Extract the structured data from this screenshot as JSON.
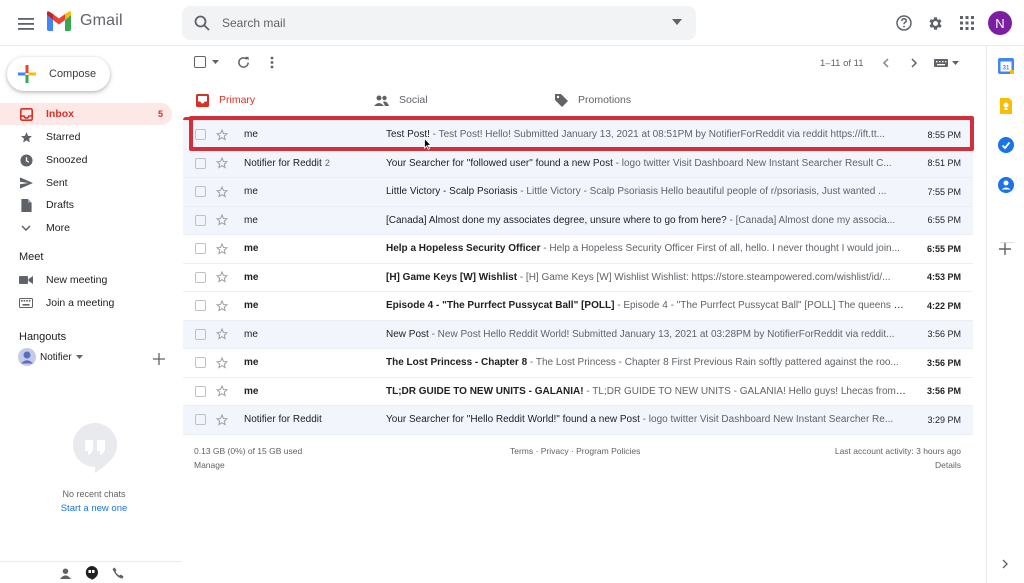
{
  "app": {
    "name": "Gmail",
    "avatar_letter": "N",
    "brand_color": "#d93025"
  },
  "search": {
    "placeholder": "Search mail"
  },
  "icons": [
    "menu-icon",
    "search-icon",
    "help-icon",
    "settings-icon",
    "apps-icon",
    "refresh-icon",
    "more-icon",
    "chevron-left-icon",
    "chevron-right-icon",
    "keyboard-icon"
  ],
  "sidebar": {
    "compose_label": "Compose",
    "items": [
      {
        "label": "Inbox",
        "count": "5",
        "icon": "inbox-icon",
        "active": true
      },
      {
        "label": "Starred",
        "icon": "star-icon"
      },
      {
        "label": "Snoozed",
        "icon": "clock-icon"
      },
      {
        "label": "Sent",
        "icon": "send-icon"
      },
      {
        "label": "Drafts",
        "icon": "draft-icon"
      },
      {
        "label": "More",
        "icon": "chevron-down-icon"
      }
    ],
    "meet": {
      "title": "Meet",
      "new_meeting": "New meeting",
      "join_meeting": "Join a meeting"
    },
    "hangouts": {
      "title": "Hangouts",
      "user": "Notifier",
      "no_chats": "No recent chats",
      "start_new": "Start a new one"
    }
  },
  "toolbar": {
    "pagination": "1–11 of 11"
  },
  "tabs": [
    {
      "label": "Primary",
      "icon": "inbox-icon"
    },
    {
      "label": "Social",
      "icon": "people-icon"
    },
    {
      "label": "Promotions",
      "icon": "tag-icon"
    }
  ],
  "emails": [
    {
      "sender": "me",
      "count": "",
      "subject": "Test Post!",
      "snippet": " - Test Post! Hello! Submitted January 13, 2021 at 08:51PM by NotifierForReddit via reddit https://ift.tt...",
      "time": "8:55 PM",
      "unread": false
    },
    {
      "sender": "Notifier for Reddit",
      "count": "2",
      "subject": "Your Searcher for \"followed user\" found a new Post",
      "snippet": " - logo twitter Visit Dashboard New Instant Searcher Result C...",
      "time": "8:51 PM",
      "unread": false
    },
    {
      "sender": "me",
      "count": "",
      "subject": "Little Victory - Scalp Psoriasis",
      "snippet": " - Little Victory - Scalp Psoriasis Hello beautiful people of r/psoriasis, Just wanted ...",
      "time": "7:55 PM",
      "unread": false
    },
    {
      "sender": "me",
      "count": "",
      "subject": "[Canada] Almost done my associates degree, unsure where to go from here?",
      "snippet": " - [Canada] Almost done my associa...",
      "time": "6:55 PM",
      "unread": false
    },
    {
      "sender": "me",
      "count": "",
      "subject": "Help a Hopeless Security Officer",
      "snippet": " - Help a Hopeless Security Officer First of all, hello. I never thought I would join...",
      "time": "6:55 PM",
      "unread": true
    },
    {
      "sender": "me",
      "count": "",
      "subject": "[H] Game Keys [W] Wishlist",
      "snippet": " - [H] Game Keys [W] Wishlist Wishlist: https://store.steampowered.com/wishlist/id/...",
      "time": "4:53 PM",
      "unread": true
    },
    {
      "sender": "me",
      "count": "",
      "subject": "Episode 4 - \"The Purrfect Pussycat Ball\" [POLL]",
      "snippet": " - Episode 4 - \"The Purrfect Pussycat Ball\" [POLL] The queens ret...",
      "time": "4:22 PM",
      "unread": true
    },
    {
      "sender": "me",
      "count": "",
      "subject": "New Post",
      "snippet": " - New Post Hello Reddit World! Submitted January 13, 2021 at 03:28PM by NotifierForReddit via reddit...",
      "time": "3:56 PM",
      "unread": false
    },
    {
      "sender": "me",
      "count": "",
      "subject": "The Lost Princess - Chapter 8",
      "snippet": " - The Lost Princess - Chapter 8 First Previous Rain softly pattered against the roo...",
      "time": "3:56 PM",
      "unread": true
    },
    {
      "sender": "me",
      "count": "",
      "subject": "TL;DR GUIDE TO NEW UNITS - GALANIA!",
      "snippet": " - TL;DR GUIDE TO NEW UNITS - GALANIA! Hello guys! Lhecas from Su...",
      "time": "3:56 PM",
      "unread": true
    },
    {
      "sender": "Notifier for Reddit",
      "count": "",
      "subject": "Your Searcher for \"Hello Reddit World!\" found a new Post",
      "snippet": " - logo twitter Visit Dashboard New Instant Searcher Re...",
      "time": "3:29 PM",
      "unread": false
    }
  ],
  "footer": {
    "storage": "0.13 GB (0%) of 15 GB used",
    "manage": "Manage",
    "terms": "Terms",
    "sep": " · ",
    "privacy": "Privacy",
    "policies": "Program Policies",
    "last_activity": "Last account activity: 3 hours ago",
    "details": "Details"
  }
}
